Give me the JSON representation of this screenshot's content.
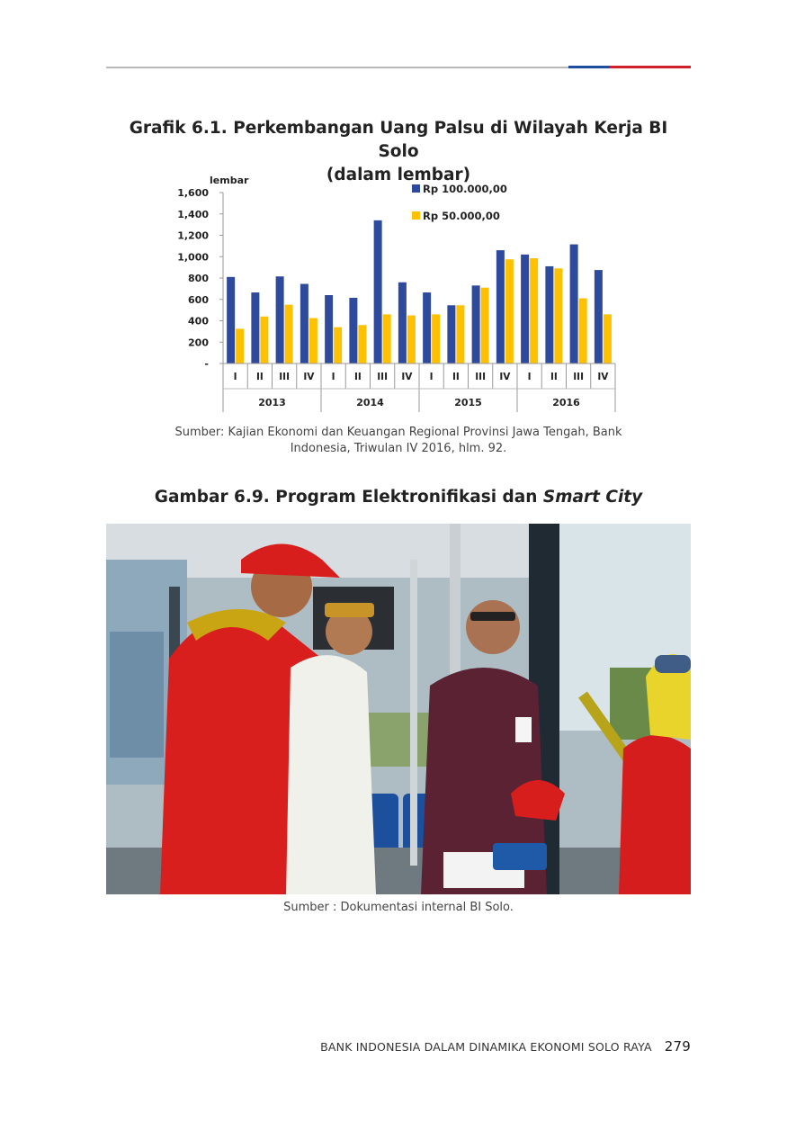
{
  "chart_title_line1": "Grafik 6.1. Perkembangan Uang Palsu di Wilayah Kerja BI Solo",
  "chart_title_line2": "(dalam lembar)",
  "chart_data": {
    "type": "bar",
    "ylabel": "lembar",
    "ylim": [
      0,
      1600
    ],
    "yticks": [
      "-",
      "200",
      "400",
      "600",
      "800",
      "1,000",
      "1,200",
      "1,400",
      "1,600"
    ],
    "categories": [
      "I",
      "II",
      "III",
      "IV",
      "I",
      "II",
      "III",
      "IV",
      "I",
      "II",
      "III",
      "IV",
      "I",
      "II",
      "III",
      "IV"
    ],
    "years": [
      "2013",
      "2014",
      "2015",
      "2016"
    ],
    "legend_position": "top-right",
    "series": [
      {
        "name": "Rp 100.000,00",
        "color": "#2e4a9c",
        "values": [
          810,
          665,
          815,
          745,
          640,
          615,
          1340,
          760,
          665,
          545,
          730,
          1060,
          1020,
          910,
          1115,
          875
        ]
      },
      {
        "name": "Rp 50.000,00",
        "color": "#ffc000",
        "values": [
          325,
          440,
          550,
          425,
          340,
          360,
          460,
          450,
          460,
          545,
          710,
          975,
          985,
          890,
          610,
          460
        ]
      }
    ]
  },
  "chart_source_line1": "Sumber: Kajian Ekonomi dan Keuangan Regional Provinsi Jawa Tengah, Bank",
  "chart_source_line2": "Indonesia, Triwulan IV 2016, hlm. 92.",
  "figure_title_prefix": "Gambar 6.9. Program Elektronifikasi dan ",
  "figure_title_italic": "Smart City",
  "figure_source": "Sumber : Dokumentasi internal BI Solo.",
  "footer_text": "BANK INDONESIA DALAM DINAMIKA EKONOMI SOLO RAYA",
  "page_number": "279"
}
